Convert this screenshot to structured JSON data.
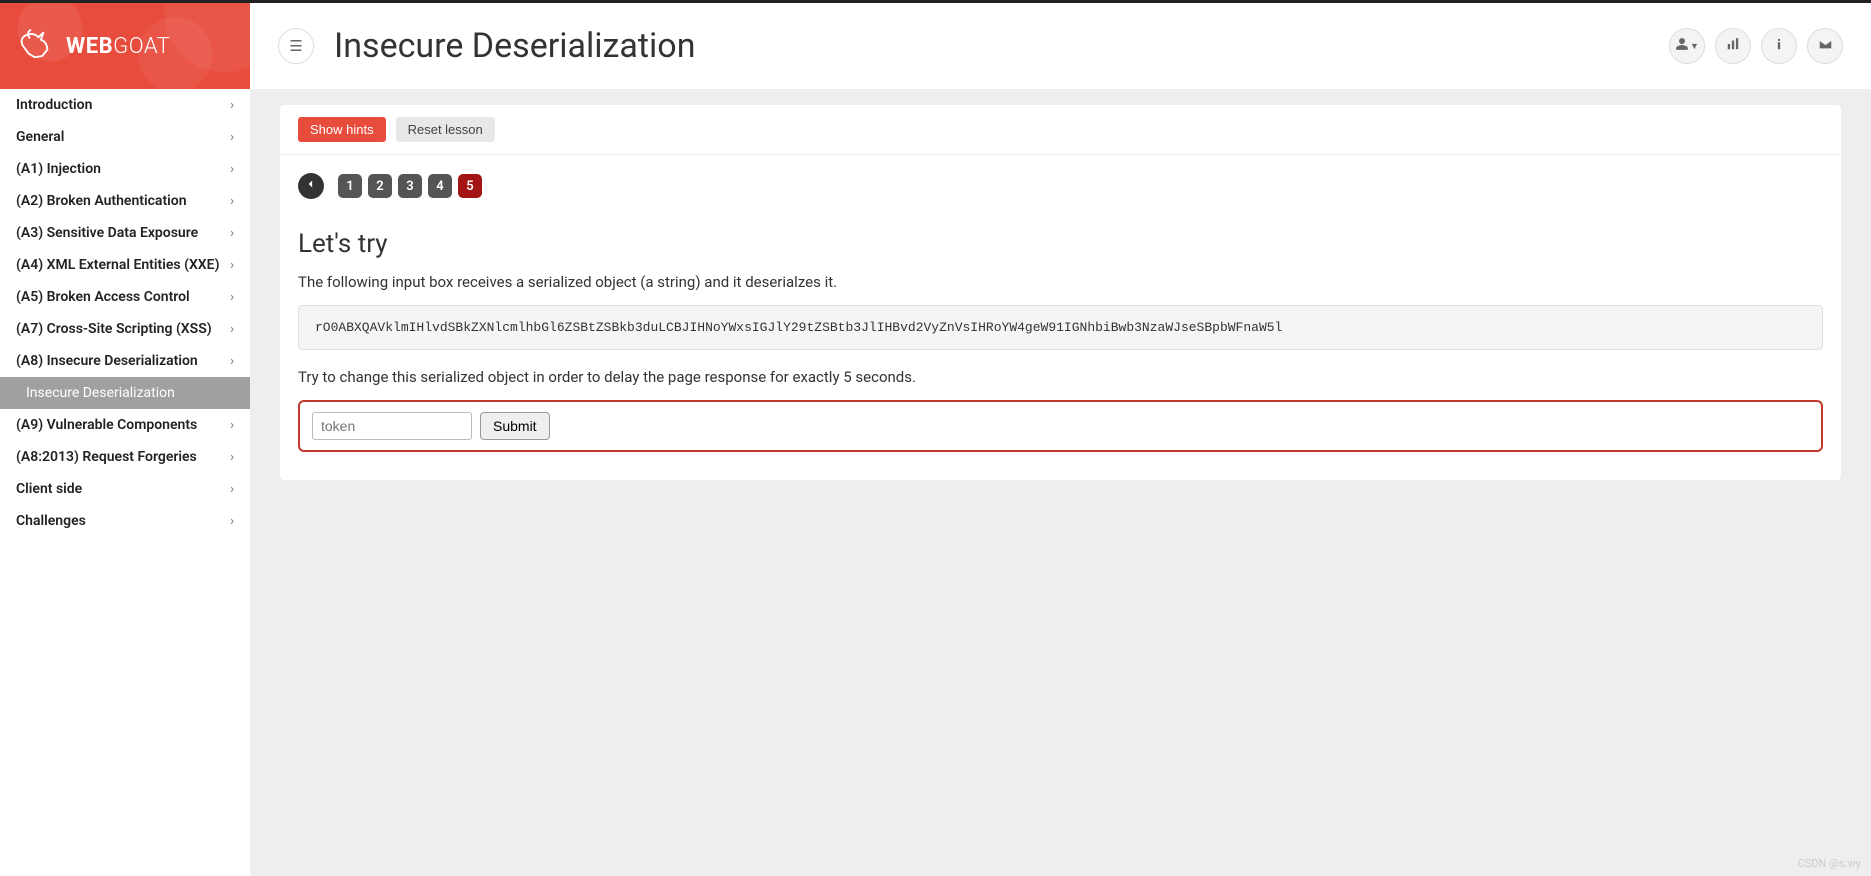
{
  "brand": {
    "bold": "WEB",
    "light": "GOAT"
  },
  "header": {
    "title": "Insecure Deserialization"
  },
  "nav": {
    "items": [
      {
        "label": "Introduction"
      },
      {
        "label": "General"
      },
      {
        "label": "(A1) Injection"
      },
      {
        "label": "(A2) Broken Authentication"
      },
      {
        "label": "(A3) Sensitive Data Exposure"
      },
      {
        "label": "(A4) XML External Entities (XXE)"
      },
      {
        "label": "(A5) Broken Access Control"
      },
      {
        "label": "(A7) Cross-Site Scripting (XSS)"
      },
      {
        "label": "(A8) Insecure Deserialization",
        "sub": "Insecure Deserialization"
      },
      {
        "label": "(A9) Vulnerable Components"
      },
      {
        "label": "(A8:2013) Request Forgeries"
      },
      {
        "label": "Client side"
      },
      {
        "label": "Challenges"
      }
    ]
  },
  "actions": {
    "show_hints": "Show hints",
    "reset_lesson": "Reset lesson"
  },
  "pages": [
    "1",
    "2",
    "3",
    "4",
    "5"
  ],
  "active_page": "5",
  "lesson": {
    "heading": "Let's try",
    "intro": "The following input box receives a serialized object (a string) and it deserialzes it.",
    "serialized": "rO0ABXQAVklmIHlvdSBkZXNlcmlhbGl6ZSBtZSBkb3duLCBJIHNoYWxsIGJlY29tZSBtb3JlIHBvd2VyZnVsIHRoYW4geW91IGNhbiBwb3NzaWJseSBpbWFnaW5l",
    "instruction": "Try to change this serialized object in order to delay the page response for exactly 5 seconds.",
    "token_placeholder": "token",
    "submit_label": "Submit"
  },
  "watermark": "CSDN @s.wy"
}
